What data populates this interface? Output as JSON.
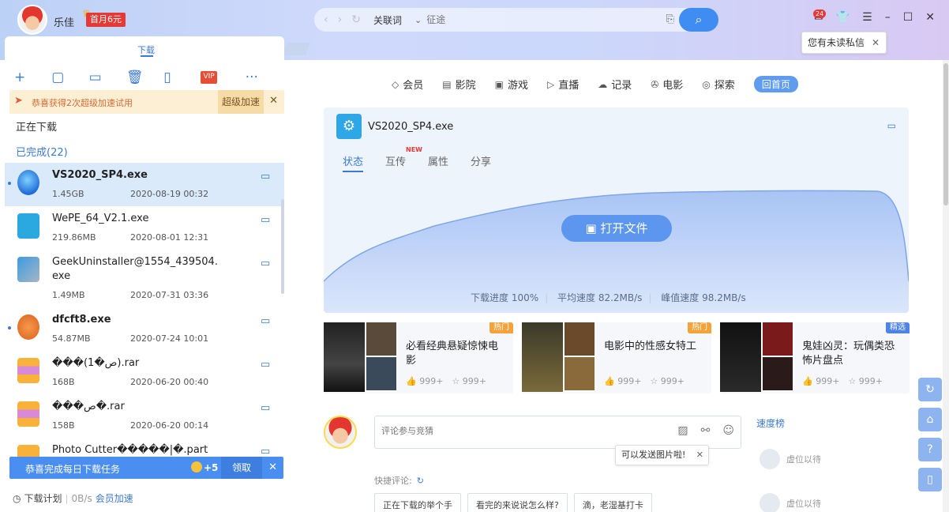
{
  "header": {
    "username": "乐佳",
    "vip_badge": "首月6元",
    "nav_back": "‹",
    "nav_fwd": "›",
    "nav_refresh": "↻",
    "search_type": "关联词",
    "search_placeholder": "征途",
    "unread_count": "24",
    "unread_tip": "您有未读私信",
    "tip_close": "✕"
  },
  "left": {
    "tab": "下载",
    "promo_text": "恭喜获得2次超级加速试用",
    "promo_button": "超级加速",
    "promo_close": "✕",
    "vip_label": "VIP",
    "downloading": "正在下载",
    "completed": "已完成(22)",
    "files": [
      {
        "name": "VS2020_SP4.exe",
        "size": "1.45GB",
        "date": "2020-08-19 00:32"
      },
      {
        "name": "WePE_64_V2.1.exe",
        "size": "219.86MB",
        "date": "2020-08-01 12:31"
      },
      {
        "name": "GeekUninstaller@1554_439504.",
        "name2": "exe",
        "size": "1.49MB",
        "date": "2020-07-31 03:36"
      },
      {
        "name": "dfcft8.exe",
        "size": "54.87MB",
        "date": "2020-07-24 10:01"
      },
      {
        "name": "���(1�ص).rar",
        "size": "168B",
        "date": "2020-06-20 00:40"
      },
      {
        "name": "���ص�.rar",
        "size": "158B",
        "date": "2020-06-20 00:14"
      },
      {
        "name": "Photo Cutter�����|�.part",
        "size": "",
        "date": ""
      }
    ],
    "task_text": "恭喜完成每日下载任务",
    "task_points": "+5",
    "task_claim": "领取",
    "task_close": "✕",
    "footer_plan": "下载计划",
    "footer_speed": "0B/s",
    "footer_vip": "会员加速"
  },
  "main": {
    "nav": [
      "会员",
      "影院",
      "游戏",
      "直播",
      "记录",
      "电影",
      "探索"
    ],
    "home": "回首页",
    "file_title": "VS2020_SP4.exe",
    "tabs": [
      "状态",
      "互传",
      "属性",
      "分享"
    ],
    "new_tag": "NEW",
    "open_button": "打开文件",
    "progress_label": "下载进度 100%",
    "avg_speed": "平均速度 82.2MB/s",
    "peak_speed": "峰值速度 98.2MB/s",
    "recs": [
      {
        "tag": "热门",
        "title": "必看经典悬疑惊悚电影",
        "likes": "999+",
        "favs": "999+"
      },
      {
        "tag": "热门",
        "title": "电影中的性感女特工",
        "likes": "999+",
        "favs": "999+"
      },
      {
        "tag": "精选",
        "title": "鬼娃凶灵：玩偶类恐怖片盘点",
        "likes": "999+",
        "favs": "999+"
      }
    ],
    "comment_placeholder": "评论参与竞猜",
    "image_tip": "可以发送图片啦!",
    "quick_label": "快捷评论:",
    "chips": [
      "正在下载的举个手",
      "看完的来说说怎么样?",
      "滴，老湿基打卡"
    ],
    "speed_rank": "速度榜",
    "rank_items": [
      "虚位以待",
      "虚位以待"
    ]
  },
  "colors": {
    "accent": "#3a7ad8",
    "brand": "#4b8ef2"
  }
}
